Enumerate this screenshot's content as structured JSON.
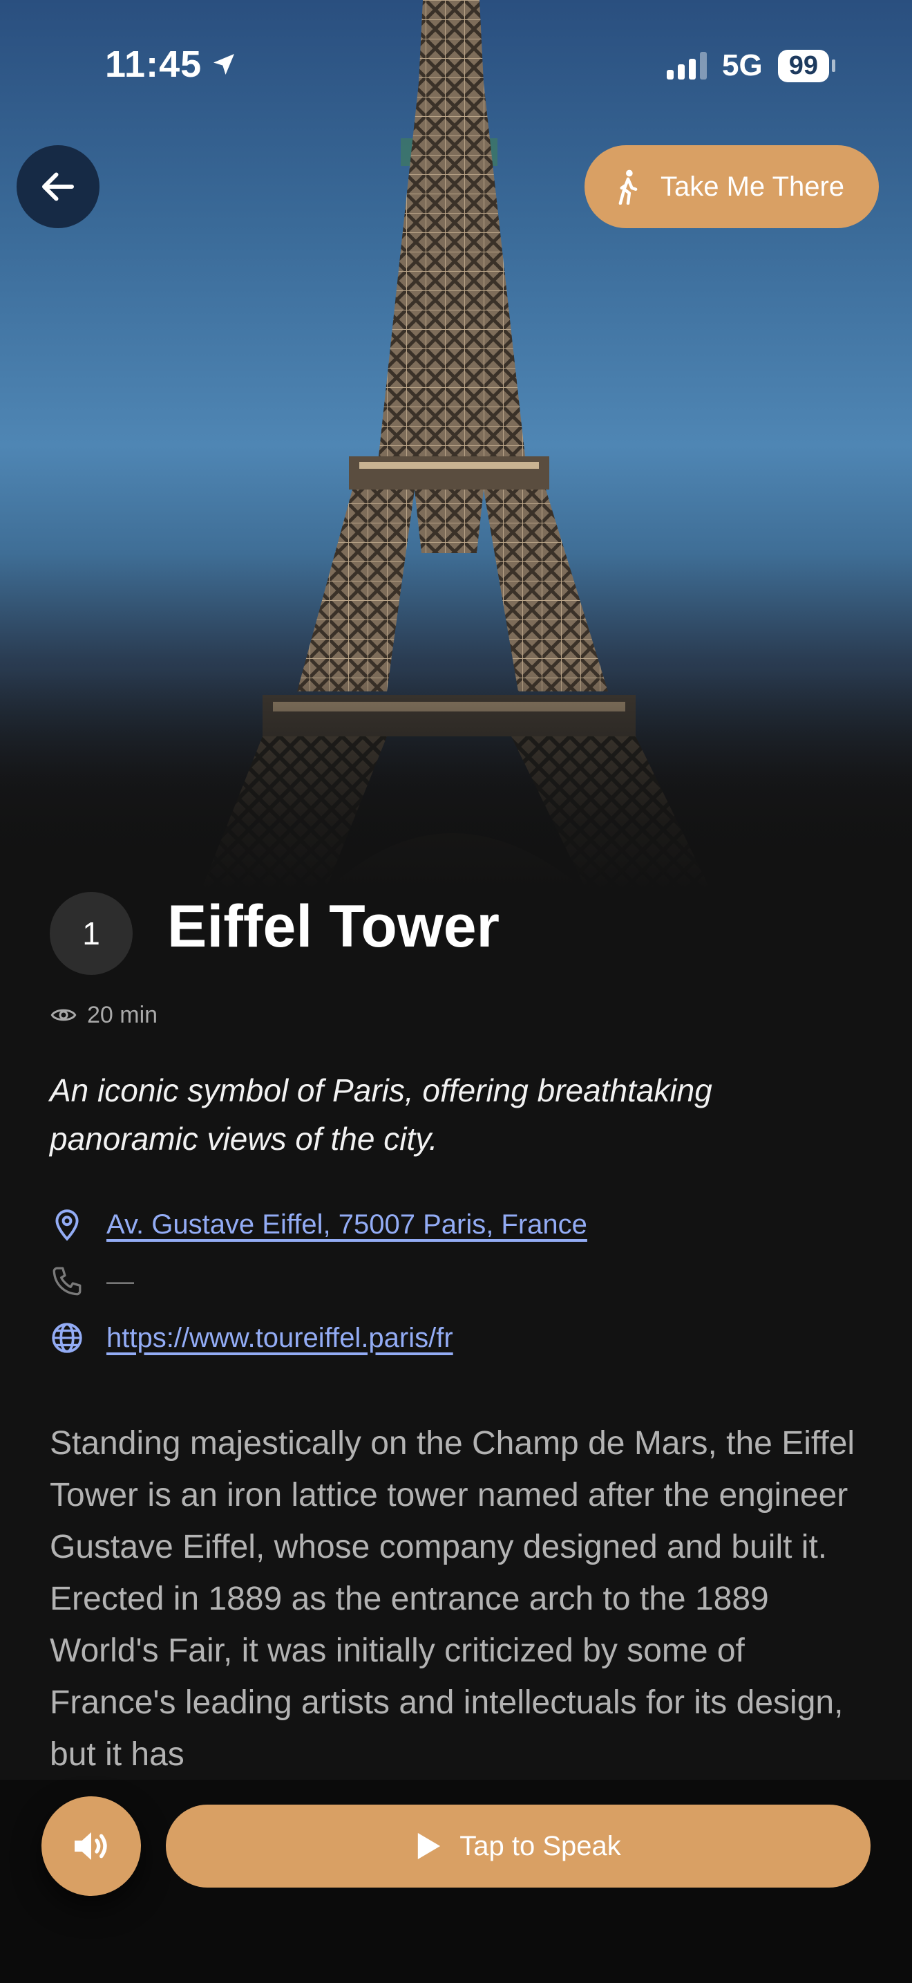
{
  "status_bar": {
    "time": "11:45",
    "network": "5G",
    "battery": "99"
  },
  "header": {
    "take_me_there_label": "Take Me There"
  },
  "stop": {
    "number": "1",
    "title": "Eiffel Tower",
    "duration": "20 min",
    "tagline": "An iconic symbol of Paris, offering breathtaking panoramic views of the city.",
    "address": "Av. Gustave Eiffel, 75007 Paris, France",
    "phone": "—",
    "website": "https://www.toureiffel.paris/fr",
    "description": "Standing majestically on the Champ de Mars, the Eiffel Tower is an iron lattice tower named after the engineer Gustave Eiffel, whose company designed and built it. Erected in 1889 as the entrance arch to the 1889 World's Fair, it was initially criticized by some of France's leading artists and intellectuals for its design, but it has"
  },
  "bottom_bar": {
    "speak_label": "Tap to Speak"
  },
  "colors": {
    "accent": "#d9a064",
    "link": "#93acf5",
    "background": "#121212"
  }
}
